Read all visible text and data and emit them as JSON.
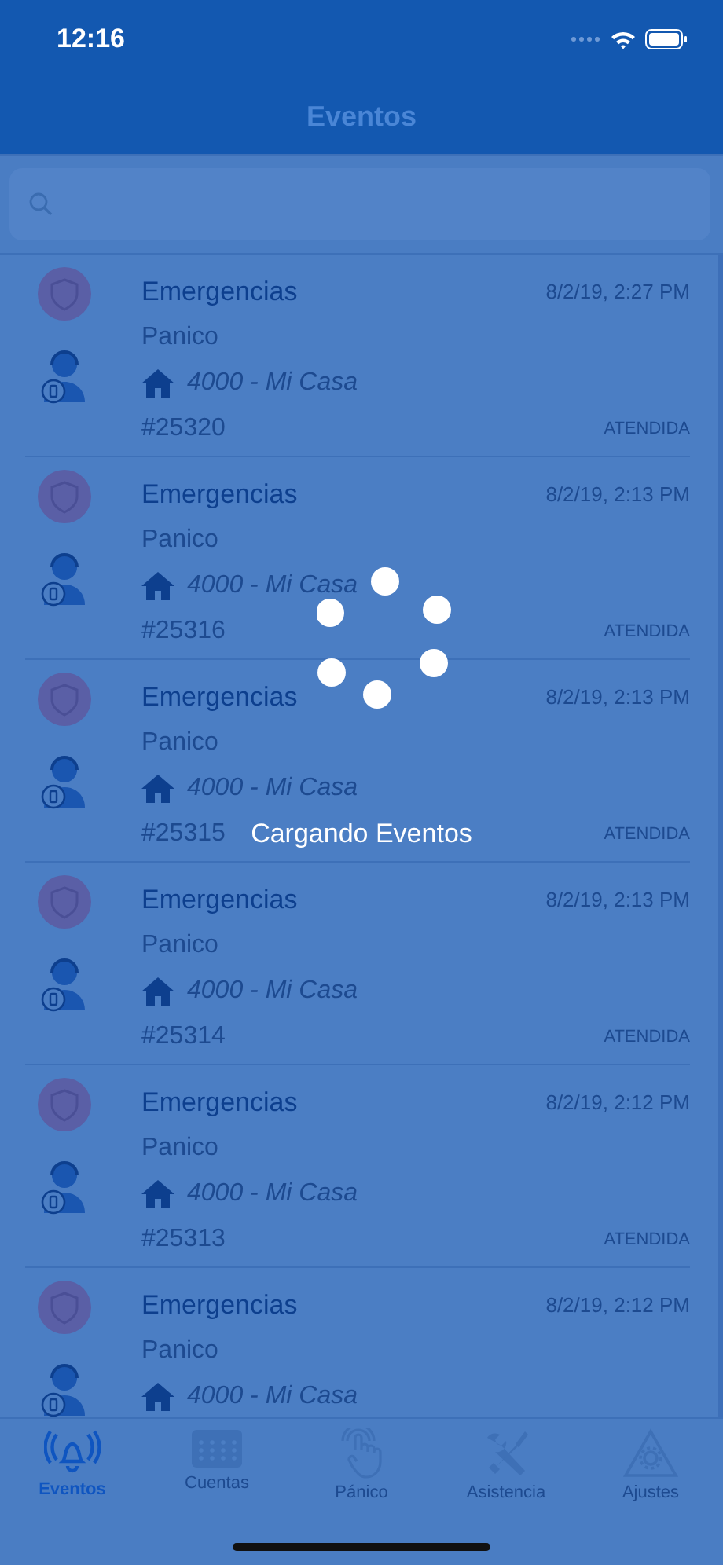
{
  "status_bar": {
    "time": "12:16"
  },
  "nav": {
    "title": "Eventos"
  },
  "events": [
    {
      "title": "Emergencias",
      "date": "8/2/19, 2:27 PM",
      "type": "Panico",
      "account": "4000 - Mi Casa",
      "number": "#25320",
      "status": "ATENDIDA"
    },
    {
      "title": "Emergencias",
      "date": "8/2/19, 2:13 PM",
      "type": "Panico",
      "account": "4000 - Mi Casa",
      "number": "#25316",
      "status": "ATENDIDA"
    },
    {
      "title": "Emergencias",
      "date": "8/2/19, 2:13 PM",
      "type": "Panico",
      "account": "4000 - Mi Casa",
      "number": "#25315",
      "status": "ATENDIDA"
    },
    {
      "title": "Emergencias",
      "date": "8/2/19, 2:13 PM",
      "type": "Panico",
      "account": "4000 - Mi Casa",
      "number": "#25314",
      "status": "ATENDIDA"
    },
    {
      "title": "Emergencias",
      "date": "8/2/19, 2:12 PM",
      "type": "Panico",
      "account": "4000 - Mi Casa",
      "number": "#25313",
      "status": "ATENDIDA"
    },
    {
      "title": "Emergencias",
      "date": "8/2/19, 2:12 PM",
      "type": "Panico",
      "account": "4000 - Mi Casa"
    }
  ],
  "loading": {
    "text": "Cargando Eventos"
  },
  "tabs": [
    {
      "kind": "bell",
      "label": "Eventos",
      "selected": true
    },
    {
      "kind": "keypad",
      "label": "Cuentas",
      "selected": false
    },
    {
      "kind": "hand",
      "label": "Pánico",
      "selected": false
    },
    {
      "kind": "tools",
      "label": "Asistencia",
      "selected": false
    },
    {
      "kind": "warning",
      "label": "Ajustes",
      "selected": false
    }
  ]
}
